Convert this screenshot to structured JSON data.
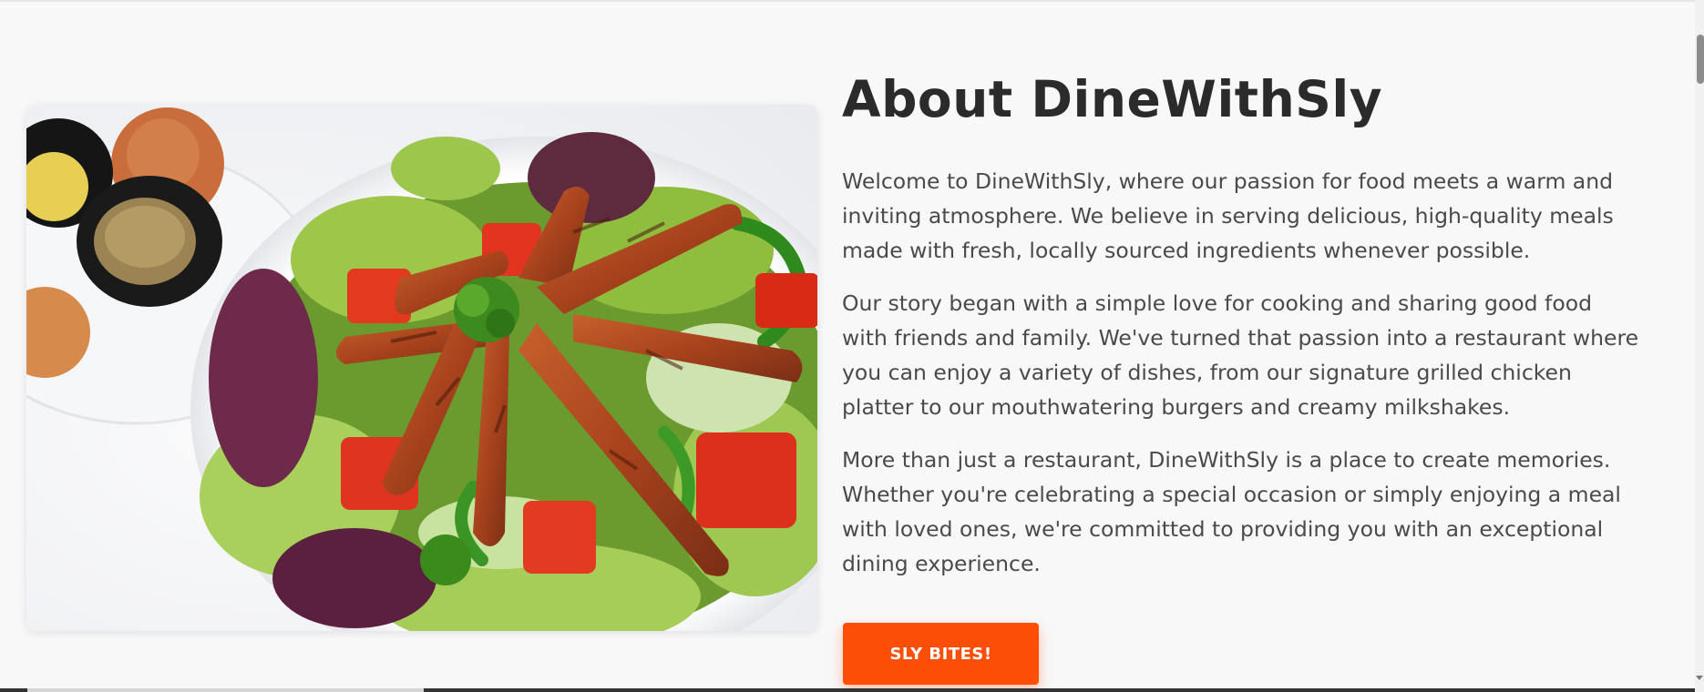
{
  "about": {
    "title": "About DineWithSly",
    "paragraphs": [
      "Welcome to DineWithSly, where our passion for food meets a warm and inviting atmosphere. We believe in serving delicious, high-quality meals made with fresh, locally sourced ingredients whenever possible.",
      "Our story began with a simple love for cooking and sharing good food with friends and family. We've turned that passion into a restaurant where you can enjoy a variety of dishes, from our signature grilled chicken platter to our mouthwatering burgers and creamy milkshakes.",
      "More than just a restaurant, DineWithSly is a place to create memories. Whether you're celebrating a special occasion or simply enjoying a meal with loved ones, we're committed to providing you with an exceptional dining experience."
    ],
    "cta_label": "SLY BITES!",
    "accent_color": "#fd4e07"
  },
  "image": {
    "subject": "grilled-chicken-salad-photo"
  }
}
